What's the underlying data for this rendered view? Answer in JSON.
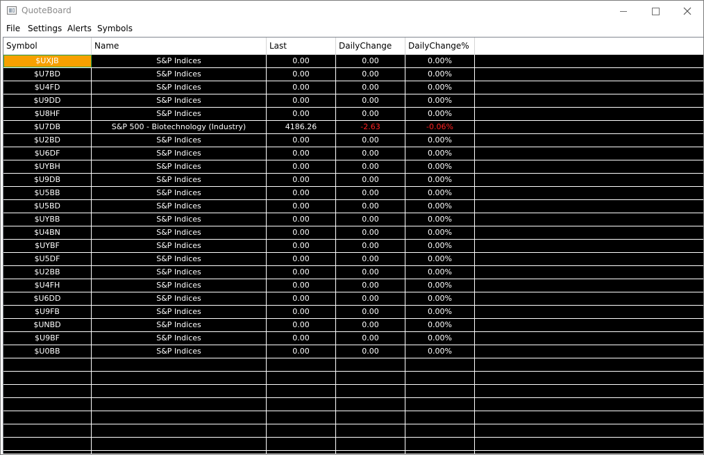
{
  "window": {
    "title": "QuoteBoard"
  },
  "menu": [
    "File",
    "Settings",
    "Alerts",
    "Symbols"
  ],
  "columns": [
    "Symbol",
    "Name",
    "Last",
    "DailyChange",
    "DailyChange%"
  ],
  "rows": [
    {
      "symbol": "$UXJB",
      "name": "S&P Indices",
      "last": "0.00",
      "change": "0.00",
      "change_pct": "0.00%"
    },
    {
      "symbol": "$U7BD",
      "name": "S&P Indices",
      "last": "0.00",
      "change": "0.00",
      "change_pct": "0.00%"
    },
    {
      "symbol": "$U4FD",
      "name": "S&P Indices",
      "last": "0.00",
      "change": "0.00",
      "change_pct": "0.00%"
    },
    {
      "symbol": "$U9DD",
      "name": "S&P Indices",
      "last": "0.00",
      "change": "0.00",
      "change_pct": "0.00%"
    },
    {
      "symbol": "$U8HF",
      "name": "S&P Indices",
      "last": "0.00",
      "change": "0.00",
      "change_pct": "0.00%"
    },
    {
      "symbol": "$U7DB",
      "name": "S&P 500 - Biotechnology (Industry)",
      "last": "4186.26",
      "change": "-2.63",
      "change_pct": "-0.06%"
    },
    {
      "symbol": "$U2BD",
      "name": "S&P Indices",
      "last": "0.00",
      "change": "0.00",
      "change_pct": "0.00%"
    },
    {
      "symbol": "$U6DF",
      "name": "S&P Indices",
      "last": "0.00",
      "change": "0.00",
      "change_pct": "0.00%"
    },
    {
      "symbol": "$UYBH",
      "name": "S&P Indices",
      "last": "0.00",
      "change": "0.00",
      "change_pct": "0.00%"
    },
    {
      "symbol": "$U9DB",
      "name": "S&P Indices",
      "last": "0.00",
      "change": "0.00",
      "change_pct": "0.00%"
    },
    {
      "symbol": "$U5BB",
      "name": "S&P Indices",
      "last": "0.00",
      "change": "0.00",
      "change_pct": "0.00%"
    },
    {
      "symbol": "$U5BD",
      "name": "S&P Indices",
      "last": "0.00",
      "change": "0.00",
      "change_pct": "0.00%"
    },
    {
      "symbol": "$UYBB",
      "name": "S&P Indices",
      "last": "0.00",
      "change": "0.00",
      "change_pct": "0.00%"
    },
    {
      "symbol": "$U4BN",
      "name": "S&P Indices",
      "last": "0.00",
      "change": "0.00",
      "change_pct": "0.00%"
    },
    {
      "symbol": "$UYBF",
      "name": "S&P Indices",
      "last": "0.00",
      "change": "0.00",
      "change_pct": "0.00%"
    },
    {
      "symbol": "$U5DF",
      "name": "S&P Indices",
      "last": "0.00",
      "change": "0.00",
      "change_pct": "0.00%"
    },
    {
      "symbol": "$U2BB",
      "name": "S&P Indices",
      "last": "0.00",
      "change": "0.00",
      "change_pct": "0.00%"
    },
    {
      "symbol": "$U4FH",
      "name": "S&P Indices",
      "last": "0.00",
      "change": "0.00",
      "change_pct": "0.00%"
    },
    {
      "symbol": "$U6DD",
      "name": "S&P Indices",
      "last": "0.00",
      "change": "0.00",
      "change_pct": "0.00%"
    },
    {
      "symbol": "$U9FB",
      "name": "S&P Indices",
      "last": "0.00",
      "change": "0.00",
      "change_pct": "0.00%"
    },
    {
      "symbol": "$UNBD",
      "name": "S&P Indices",
      "last": "0.00",
      "change": "0.00",
      "change_pct": "0.00%"
    },
    {
      "symbol": "$U9BF",
      "name": "S&P Indices",
      "last": "0.00",
      "change": "0.00",
      "change_pct": "0.00%"
    },
    {
      "symbol": "$U0BB",
      "name": "S&P Indices",
      "last": "0.00",
      "change": "0.00",
      "change_pct": "0.00%"
    }
  ],
  "selected_row": 0,
  "negative_rows": [
    5
  ],
  "empty_rows": 8,
  "colors": {
    "grid_background": "#000000",
    "grid_text": "#ffffff",
    "negative_text": "#ff2020",
    "selection": "#f7a000"
  }
}
